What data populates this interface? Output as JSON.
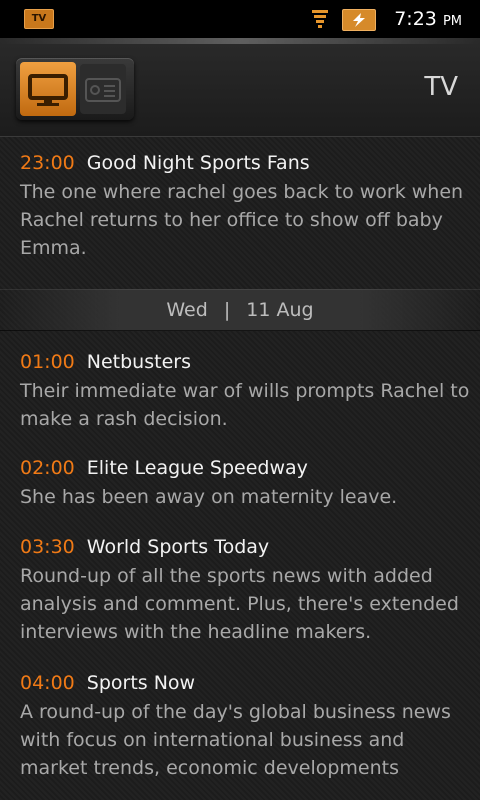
{
  "status_bar": {
    "tv_badge": "TV",
    "time": "7:23",
    "ampm": "PM"
  },
  "header": {
    "title": "TV"
  },
  "programs_top": [
    {
      "time": "23:00",
      "title": "Good Night Sports Fans",
      "description": "The one where rachel goes back to work when Rachel returns to her office to show off baby Emma."
    }
  ],
  "date_divider": {
    "day": "Wed",
    "separator": "|",
    "date": "11 Aug"
  },
  "programs": [
    {
      "time": "01:00",
      "title": "Netbusters",
      "description": "Their immediate war of wills prompts Rachel to make a rash decision."
    },
    {
      "time": "02:00",
      "title": "Elite League Speedway",
      "description": "She has been away on maternity leave."
    },
    {
      "time": "03:30",
      "title": "World Sports Today",
      "description": "Round-up of all the sports news with added analysis and comment. Plus, there's extended interviews with the headline makers."
    },
    {
      "time": "04:00",
      "title": "Sports Now",
      "description": "A round-up of the day's global business news with focus on international business and market trends, economic developments"
    }
  ],
  "colors": {
    "accent": "#f07a16",
    "title_text": "#f2f2f2",
    "description_text": "#a8a8a8"
  }
}
